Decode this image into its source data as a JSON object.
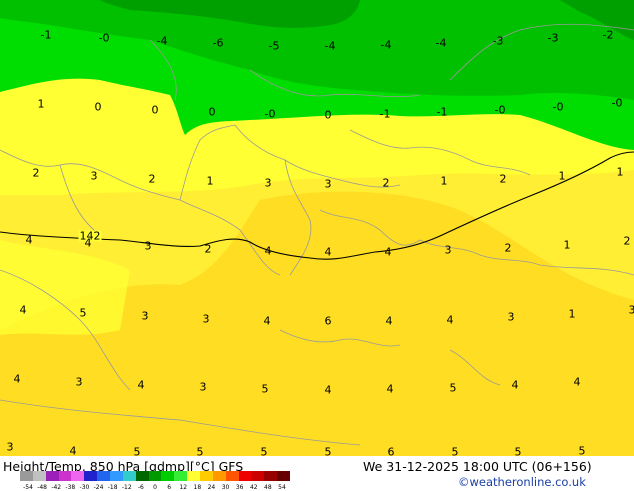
{
  "title": "Height/Temp. 850 hPa [gdmp][°C] GFS",
  "valid_time": "We 31-12-2025 18:00 UTC (06+156)",
  "credit": "©weatheronline.co.uk",
  "contour_label": "142",
  "colorbar": {
    "tick_labels": [
      "-54",
      "-48",
      "-42",
      "-38",
      "-30",
      "-24",
      "-18",
      "-12",
      "-6",
      "0",
      "6",
      "12",
      "18",
      "24",
      "30",
      "36",
      "42",
      "48",
      "54"
    ],
    "colors": [
      "#9a9a9a",
      "#c0c0c0",
      "#9b1fb8",
      "#cc33cc",
      "#ee66ee",
      "#2222cc",
      "#2266ee",
      "#3399ff",
      "#33cccc",
      "#006600",
      "#009900",
      "#00cc00",
      "#33ee33",
      "#ffff33",
      "#ffcc00",
      "#ff9900",
      "#ff5500",
      "#ee0000",
      "#cc0000",
      "#990000",
      "#660000"
    ]
  },
  "map_colors": {
    "dark_green": "#00a000",
    "green": "#00c000",
    "light_green": "#00dd00",
    "yellow": "#ffff33",
    "yellow_warm": "#ffee33",
    "yellow_orange": "#ffdd22",
    "boundary": "#9a9a9a",
    "contour": "#000000"
  },
  "temperature_labels": [
    {
      "t": "-1"
    },
    {
      "t": "-0"
    },
    {
      "t": "-4"
    },
    {
      "t": "-6"
    },
    {
      "t": "-5"
    },
    {
      "t": "-4"
    },
    {
      "t": "-4"
    },
    {
      "t": "-4"
    },
    {
      "t": "-3"
    },
    {
      "t": "-3"
    },
    {
      "t": "-2"
    },
    {
      "t": "1"
    },
    {
      "t": "0"
    },
    {
      "t": "0"
    },
    {
      "t": "0"
    },
    {
      "t": "-0"
    },
    {
      "t": "0"
    },
    {
      "t": "-1"
    },
    {
      "t": "-1"
    },
    {
      "t": "-0"
    },
    {
      "t": "-0"
    },
    {
      "t": "-0"
    },
    {
      "t": "2"
    },
    {
      "t": "3"
    },
    {
      "t": "2"
    },
    {
      "t": "1"
    },
    {
      "t": "3"
    },
    {
      "t": "3"
    },
    {
      "t": "2"
    },
    {
      "t": "1"
    },
    {
      "t": "2"
    },
    {
      "t": "1"
    },
    {
      "t": "1"
    },
    {
      "t": "4"
    },
    {
      "t": "4"
    },
    {
      "t": "3"
    },
    {
      "t": "2"
    },
    {
      "t": "4"
    },
    {
      "t": "4"
    },
    {
      "t": "4"
    },
    {
      "t": "3"
    },
    {
      "t": "2"
    },
    {
      "t": "1"
    },
    {
      "t": "2"
    },
    {
      "t": "4"
    },
    {
      "t": "5"
    },
    {
      "t": "3"
    },
    {
      "t": "3"
    },
    {
      "t": "4"
    },
    {
      "t": "6"
    },
    {
      "t": "4"
    },
    {
      "t": "4"
    },
    {
      "t": "3"
    },
    {
      "t": "1"
    },
    {
      "t": "3"
    },
    {
      "t": "4"
    },
    {
      "t": "3"
    },
    {
      "t": "4"
    },
    {
      "t": "3"
    },
    {
      "t": "5"
    },
    {
      "t": "4"
    },
    {
      "t": "4"
    },
    {
      "t": "5"
    },
    {
      "t": "4"
    },
    {
      "t": "4"
    },
    {
      "t": "3"
    },
    {
      "t": "4"
    },
    {
      "t": "5"
    },
    {
      "t": "5"
    },
    {
      "t": "5"
    },
    {
      "t": "5"
    },
    {
      "t": "6"
    },
    {
      "t": "5"
    },
    {
      "t": "5"
    },
    {
      "t": "5"
    }
  ]
}
